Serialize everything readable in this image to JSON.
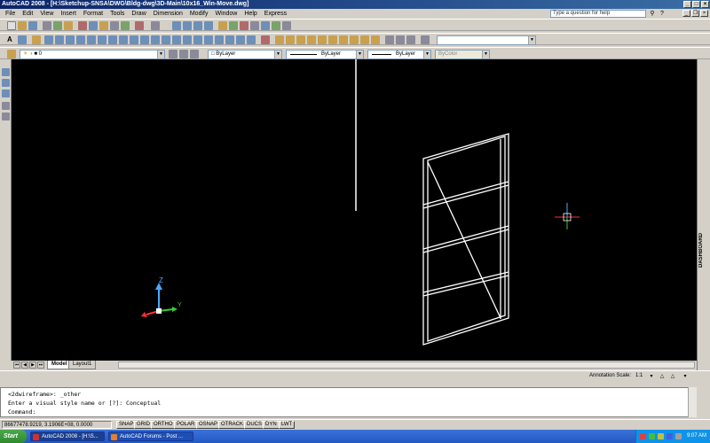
{
  "app": {
    "title": "AutoCAD 2008 - [H:\\Sketchup-SNSA\\DWG\\Bldg-dwg\\3D-Main\\10x16_Win-Move.dwg]"
  },
  "menu": {
    "items": [
      "File",
      "Edit",
      "View",
      "Insert",
      "Format",
      "Tools",
      "Draw",
      "Dimension",
      "Modify",
      "Window",
      "Help",
      "Express"
    ],
    "help_placeholder": "Type a question for help"
  },
  "toolbars": {
    "layer_value": "0",
    "color_value": "ByLayer",
    "linetype_value": "ByLayer",
    "lineweight_value": "ByLayer",
    "plotstyle_value": "ByColor"
  },
  "viewport": {
    "bg": "#000000",
    "ucs_labels": {
      "z": "Z",
      "y": "Y"
    },
    "colors": {
      "z": "#4aa8ff",
      "x": "#ff3030",
      "y": "#30d030",
      "wire": "#ffffff"
    }
  },
  "right_panel": {
    "label": "DASHBOARD"
  },
  "layout_tabs": {
    "model": "Model",
    "layout1": "Layout1"
  },
  "annotation": {
    "label": "Annotation Scale:",
    "value": "1:1"
  },
  "command_window": {
    "lines": [
      "<2dwireframe>: _other",
      "Enter a visual style name or [?]: Conceptual",
      "Command:"
    ]
  },
  "status": {
    "coords": "86677478.9219, 3.1906E+08, 0.0000",
    "toggles": [
      "SNAP",
      "GRID",
      "ORTHO",
      "POLAR",
      "OSNAP",
      "OTRACK",
      "DUCS",
      "DYN",
      "LWT"
    ]
  },
  "taskbar": {
    "start": "Start",
    "tasks": [
      "AutoCAD 2008 - [H:\\S...",
      "AutoCAD Forums - Post ..."
    ],
    "clock": "9:07 AM"
  }
}
